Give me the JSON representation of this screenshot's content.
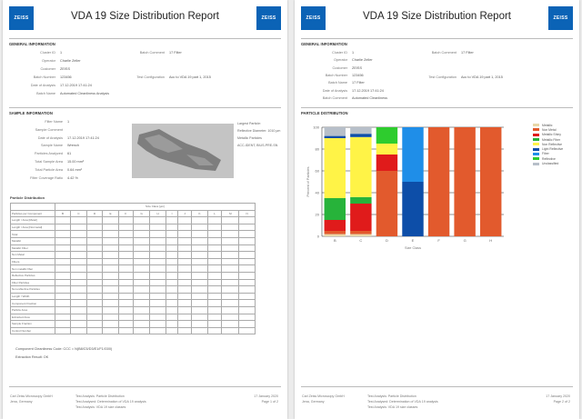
{
  "report_title": "VDA 19 Size Distribution Report",
  "logo_text": "ZEISS",
  "left_page": {
    "info_section": "General Information",
    "info_fields": [
      {
        "label": "Cluster ID",
        "value": "1"
      },
      {
        "label": "Operator",
        "value": "Charlie Zeller"
      },
      {
        "label": "Customer",
        "value": "ZEISS"
      },
      {
        "label": "Batch Number",
        "value": "123456"
      },
      {
        "label": "Date of Analysis",
        "value": "17.12.2019 17:41:24"
      },
      {
        "label": "Batch Name",
        "value": "Automated Cleanliness Analysis"
      }
    ],
    "info_fields_right": [
      {
        "label": "Batch Comment",
        "value": "17 Filter"
      },
      {
        "label": "Test Configuration",
        "value": "Acc to VDA 19 part 1, 2015"
      }
    ],
    "sample_section": "Sample Information",
    "sample_fields": [
      {
        "label": "Filter Name",
        "value": "1"
      },
      {
        "label": "Sample Comment",
        "value": ""
      },
      {
        "label": "Date of Analysis",
        "value": "17.12.2019 17:41:24"
      },
      {
        "label": "Sample Name",
        "value": "Wrench"
      },
      {
        "label": "Particles Analyzed",
        "value": "61"
      },
      {
        "label": "Total Sample Area",
        "value": "15.00 mm²"
      },
      {
        "label": "Total Particle Area",
        "value": "0.64 mm²"
      },
      {
        "label": "Filter Coverage Ratio",
        "value": "4.42 %"
      }
    ],
    "particle_notes": [
      "Largest Particle:",
      "Reflective Diameter: 1010 µm",
      "Metallic Particles",
      "ACC-IDENT, BIUS-PRE-SN"
    ],
    "dist_title": "Particle Distribution",
    "size_class_header": "Size Class [µm]",
    "class_letters": [
      "B",
      "C",
      "D",
      "E",
      "F",
      "G",
      "H",
      "I",
      "J",
      "K",
      "L",
      "M",
      "N"
    ],
    "first_col_label": "Particles per Component",
    "row_labels": [
      "Length / Area [Metal]",
      "Length / Area [Nonmetal]",
      "Total",
      "Metallic",
      "Metallic Fiber",
      "Non Metal",
      "Fibers",
      "Non metallic fiber",
      "Reflective Particles",
      "Fiber Particles",
      "Non-reflective Particles",
      "Length / Width",
      "Component Fraction",
      "Particle Area",
      "Extracted Area",
      "Sample Fraction",
      "Control Number"
    ],
    "component_label": "Component Cleanliness Code: CCC = N(B8/C5/D3/E1/F1/G00)",
    "result_label": "Extraction Result: OK"
  },
  "right_page": {
    "info_section": "General Information",
    "info_fields": [
      {
        "label": "Cluster ID",
        "value": "1"
      },
      {
        "label": "Operator",
        "value": "Charlie Zeller"
      },
      {
        "label": "Customer",
        "value": "ZEISS"
      },
      {
        "label": "Batch Number",
        "value": "123456"
      },
      {
        "label": "Batch Name",
        "value": "17 Filter"
      },
      {
        "label": "Date of Analysis",
        "value": "17.12.2019 17:41:24"
      },
      {
        "label": "Batch Comment",
        "value": "Automated Cleanliness"
      }
    ],
    "info_fields_right": [
      {
        "label": "Batch Comment",
        "value": "17 Filter"
      },
      {
        "label": "Test Configuration",
        "value": "Acc to VDA 19 part 1, 2015"
      }
    ],
    "chart_section": "Particle Distribution"
  },
  "footer": {
    "left_lines": [
      "Carl Zeiss Microscopy GmbH",
      "Jena, Germany"
    ],
    "mid_lines": [
      "Test Analysis: Particle Distribution",
      "Test Analysed: Determination of VDA 19 analysis",
      "Test Analysis: VDA 19 size classes"
    ],
    "right_left_page": [
      "17 January 2020",
      "Page 1 of 2"
    ],
    "right_right_page": [
      "17 January 2020",
      "Page 2 of 2"
    ]
  },
  "chart_data": {
    "type": "bar",
    "stacked": true,
    "categories": [
      "B",
      "C",
      "D",
      "E",
      "F",
      "G",
      "H"
    ],
    "ylabel": "Percent of Particles",
    "xlabel": "Size Class",
    "ylim": [
      0,
      100
    ],
    "yticks": [
      0,
      20,
      40,
      60,
      80,
      100
    ],
    "grid": true,
    "legend_position": "right",
    "series": [
      {
        "name": "Metallic",
        "color": "#e8d7a8",
        "values": [
          2,
          2,
          0,
          0,
          0,
          0,
          0
        ]
      },
      {
        "name": "Non Metal",
        "color": "#e25a2d",
        "values": [
          3,
          3,
          60,
          0,
          100,
          100,
          100
        ]
      },
      {
        "name": "Metallic Shiny",
        "color": "#e01b1b",
        "values": [
          10,
          25,
          15,
          0,
          0,
          0,
          0
        ]
      },
      {
        "name": "Metallic Fiber",
        "color": "#27b33a",
        "values": [
          20,
          6,
          0,
          0,
          0,
          0,
          0
        ]
      },
      {
        "name": "Non Reflective",
        "color": "#fff347",
        "values": [
          55,
          55,
          10,
          0,
          0,
          0,
          0
        ]
      },
      {
        "name": "Light Reflective",
        "color": "#0d4ea8",
        "values": [
          2,
          3,
          0,
          50,
          0,
          0,
          0
        ]
      },
      {
        "name": "Fiber",
        "color": "#1f8ee8",
        "values": [
          0,
          0,
          0,
          50,
          0,
          0,
          0
        ]
      },
      {
        "name": "Reflective",
        "color": "#2ecc2e",
        "values": [
          0,
          0,
          15,
          0,
          0,
          0,
          0
        ]
      },
      {
        "name": "Unclassified",
        "color": "#b7bfc9",
        "values": [
          8,
          6,
          0,
          0,
          0,
          0,
          0
        ]
      }
    ]
  }
}
